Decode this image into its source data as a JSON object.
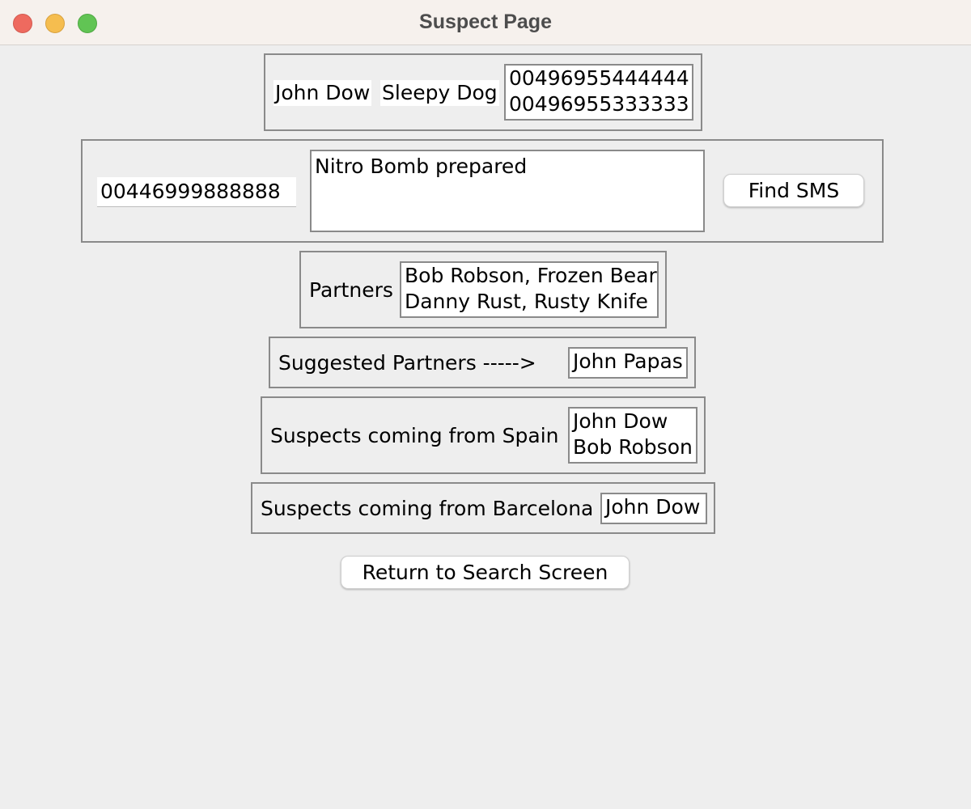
{
  "window": {
    "title": "Suspect Page"
  },
  "suspect": {
    "name": "John Dow",
    "nickname": "Sleepy Dog",
    "phones": [
      "00496955444444",
      "00496955333333"
    ]
  },
  "sms": {
    "phone_value": "00446999888888",
    "message": "Nitro Bomb prepared",
    "find_button": "Find SMS"
  },
  "partners": {
    "label": "Partners",
    "entries": [
      "Bob Robson, Frozen Bear",
      "Danny Rust, Rusty Knife"
    ]
  },
  "suggested_partners": {
    "label": "Suggested Partners ----->",
    "entries": [
      "John Papas"
    ]
  },
  "spain": {
    "label": "Suspects coming from Spain",
    "entries": [
      "John Dow",
      "Bob Robson"
    ]
  },
  "barcelona": {
    "label": "Suspects coming from Barcelona",
    "entries": [
      "John Dow"
    ]
  },
  "return_button": "Return to Search Screen"
}
